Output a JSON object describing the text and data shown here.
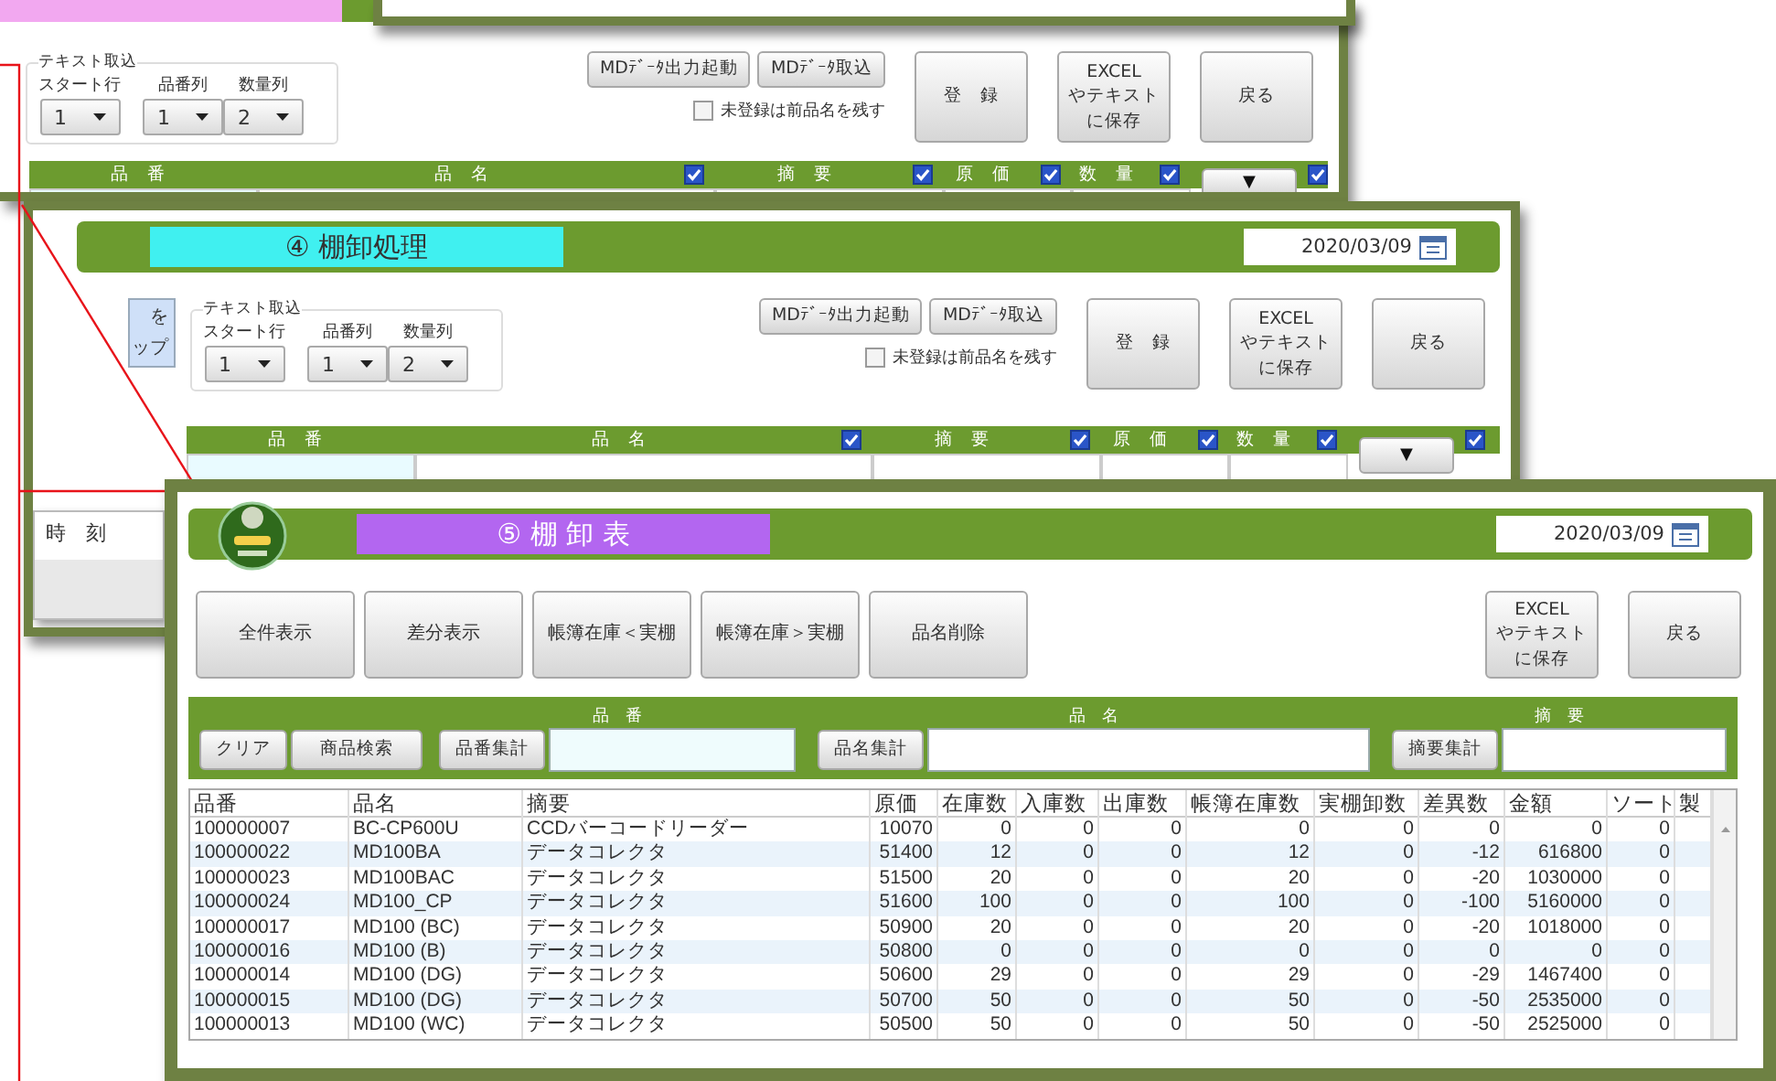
{
  "windows": [
    {
      "kind": "entry",
      "color": "#f2a8f0",
      "import": {
        "title": "テキスト取込",
        "selects": [
          {
            "label": "スタート行",
            "value": "1"
          },
          {
            "label": "品番列",
            "value": "1"
          },
          {
            "label": "数量列",
            "value": "2"
          }
        ]
      },
      "tool_buttons": [
        "MDﾃﾞｰﾀ出力起動",
        "MDﾃﾞｰﾀ取込"
      ],
      "keep_name": {
        "label": "未登録は前品名を残す",
        "checked": false
      },
      "buttons": [
        "登　録",
        "EXCEL\nやテキストに保存",
        "戻る"
      ],
      "columns": [
        {
          "kind": "plain",
          "label": "品　番"
        },
        {
          "kind": "check",
          "label": "品　名",
          "checked": true
        },
        {
          "kind": "check",
          "label": "摘　要",
          "checked": true
        },
        {
          "kind": "check",
          "label": "原　価",
          "checked": true
        },
        {
          "kind": "check",
          "label": "数　量",
          "checked": true
        }
      ],
      "dropdown": "▼",
      "all_checked": true
    },
    {
      "kind": "entry",
      "color": "#40f0f0",
      "title": "④ 棚卸処理",
      "date": "2020/03/09",
      "side_button": [
        "を",
        "ップ"
      ],
      "import": {
        "title": "テキスト取込",
        "selects": [
          {
            "label": "スタート行",
            "value": "1"
          },
          {
            "label": "品番列",
            "value": "1"
          },
          {
            "label": "数量列",
            "value": "2"
          }
        ]
      },
      "tool_buttons": [
        "MDﾃﾞｰﾀ出力起動",
        "MDﾃﾞｰﾀ取込"
      ],
      "keep_name": {
        "label": "未登録は前品名を残す",
        "checked": false
      },
      "buttons": [
        "登　録",
        "EXCEL\nやテキストに保存",
        "戻る"
      ],
      "columns": [
        {
          "kind": "plain",
          "label": "品　番"
        },
        {
          "kind": "check",
          "label": "品　名",
          "checked": true
        },
        {
          "kind": "check",
          "label": "摘　要",
          "checked": true
        },
        {
          "kind": "check",
          "label": "原　価",
          "checked": true
        },
        {
          "kind": "check",
          "label": "数　量",
          "checked": true
        }
      ],
      "dropdown": "▼",
      "all_checked": true,
      "time_header": "時　刻"
    },
    {
      "kind": "sheet",
      "color": "#b366f0",
      "title": "⑤ 棚 卸 表",
      "date": "2020/03/09",
      "buttons": [
        "全件表示",
        "差分表示",
        "帳簿在庫＜実棚",
        "帳簿在庫＞実棚",
        "品名削除"
      ],
      "right_buttons": [
        "EXCEL\nやテキストに保存",
        "戻る"
      ],
      "filters": {
        "clear": "クリア",
        "search": "商品検索",
        "groups": [
          {
            "label": "品　番",
            "button": "品番集計"
          },
          {
            "label": "品　名",
            "button": "品名集計"
          },
          {
            "label": "摘　要",
            "button": "摘要集計"
          }
        ]
      },
      "table": {
        "columns": [
          "品番",
          "品名",
          "摘要",
          "原価",
          "在庫数",
          "入庫数",
          "出庫数",
          "帳簿在庫数",
          "実棚卸数",
          "差異数",
          "金額",
          "ソート",
          "製"
        ],
        "rows": [
          [
            "100000007",
            "BC-CP600U",
            "CCDバーコードリーダー",
            "10070",
            "0",
            "0",
            "0",
            "0",
            "0",
            "0",
            "0",
            "0"
          ],
          [
            "100000022",
            "MD100BA",
            "データコレクタ",
            "51400",
            "12",
            "0",
            "0",
            "12",
            "0",
            "-12",
            "616800",
            "0"
          ],
          [
            "100000023",
            "MD100BAC",
            "データコレクタ",
            "51500",
            "20",
            "0",
            "0",
            "20",
            "0",
            "-20",
            "1030000",
            "0"
          ],
          [
            "100000024",
            "MD100_CP",
            "データコレクタ",
            "51600",
            "100",
            "0",
            "0",
            "100",
            "0",
            "-100",
            "5160000",
            "0"
          ],
          [
            "100000017",
            "MD100 (BC)",
            "データコレクタ",
            "50900",
            "20",
            "0",
            "0",
            "20",
            "0",
            "-20",
            "1018000",
            "0"
          ],
          [
            "100000016",
            "MD100 (B)",
            "データコレクタ",
            "50800",
            "0",
            "0",
            "0",
            "0",
            "0",
            "0",
            "0",
            "0"
          ],
          [
            "100000014",
            "MD100 (DG)",
            "データコレクタ",
            "50600",
            "29",
            "0",
            "0",
            "29",
            "0",
            "-29",
            "1467400",
            "0"
          ],
          [
            "100000015",
            "MD100 (DG)",
            "データコレクタ",
            "50700",
            "50",
            "0",
            "0",
            "50",
            "0",
            "-50",
            "2535000",
            "0"
          ],
          [
            "100000013",
            "MD100 (WC)",
            "データコレクタ",
            "50500",
            "50",
            "0",
            "0",
            "50",
            "0",
            "-50",
            "2525000",
            "0"
          ]
        ]
      }
    }
  ]
}
